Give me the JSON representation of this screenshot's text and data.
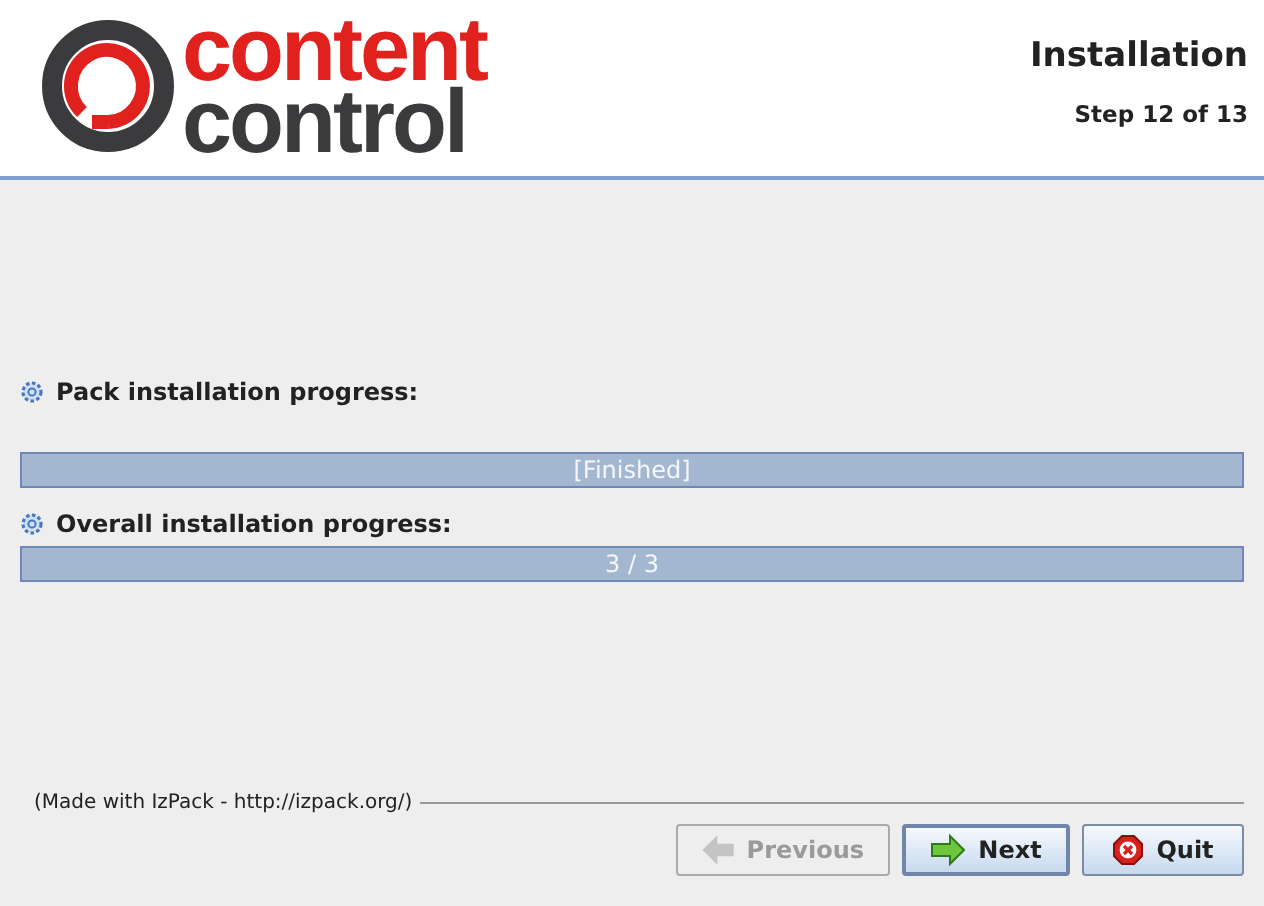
{
  "header": {
    "logo": {
      "line_1": "content",
      "line_2": "control"
    },
    "title": "Installation",
    "step": "Step 12 of 13"
  },
  "progress": [
    {
      "label": "Pack installation progress:",
      "level": 1,
      "reading": "[Finished]"
    },
    {
      "label": "Overall installation progress:",
      "level": 1,
      "reading": "3 / 3"
    }
  ],
  "footer": {
    "credit": "(Made with IzPack - http://izpack.org/)"
  },
  "buttons": [
    {
      "kind": "previous",
      "label": "Previous",
      "disabled": true
    },
    {
      "kind": "next",
      "label": "Next",
      "disabled": false
    },
    {
      "kind": "quit",
      "label": "Quit",
      "disabled": false
    }
  ]
}
